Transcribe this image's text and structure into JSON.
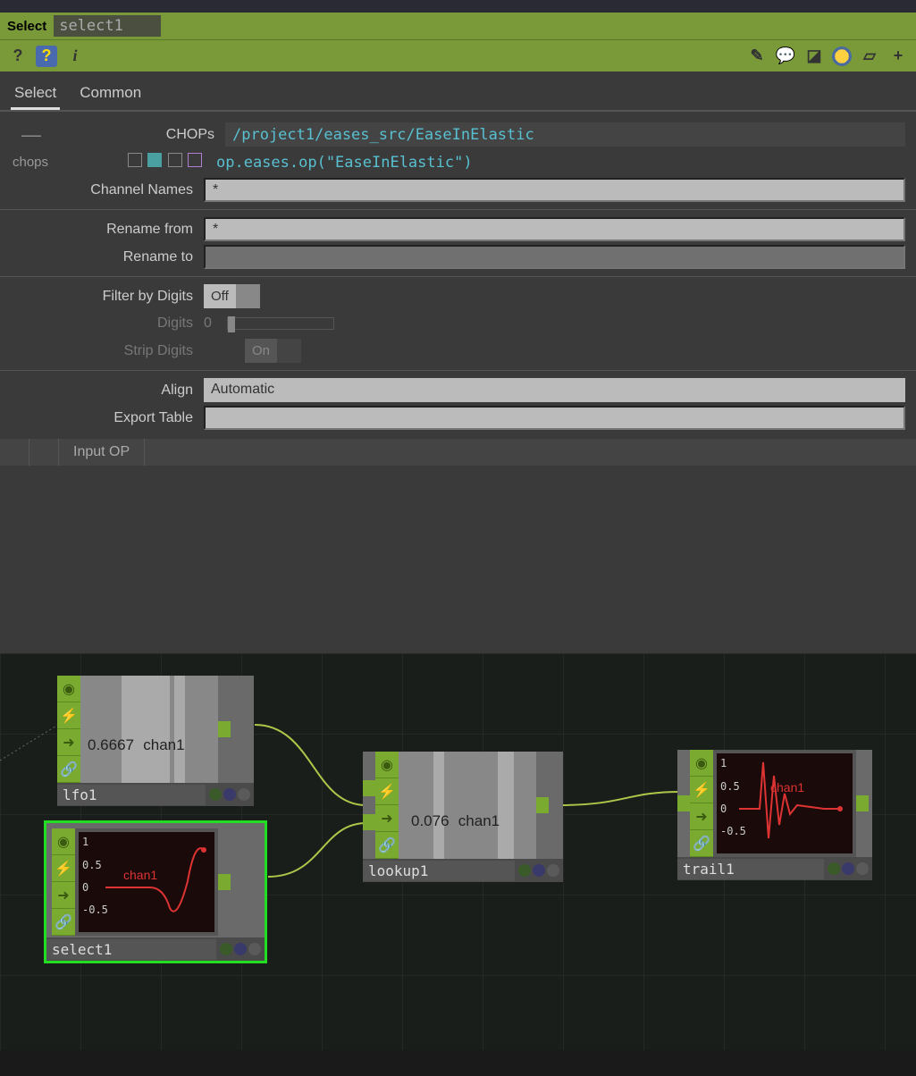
{
  "header": {
    "type_label": "Select",
    "op_name": "select1"
  },
  "tabs": {
    "select": "Select",
    "common": "Common"
  },
  "params": {
    "chops_label": "CHOPs",
    "chops_value": "/project1/eases_src/EaseInElastic",
    "chops_sublabel": "chops",
    "chops_expr": "op.eases.op(\"EaseInElastic\")",
    "channames_label": "Channel Names",
    "channames_value": "*",
    "renamefrom_label": "Rename from",
    "renamefrom_value": "*",
    "renameto_label": "Rename to",
    "renameto_value": "",
    "filterdigits_label": "Filter by Digits",
    "filterdigits_value": "Off",
    "digits_label": "Digits",
    "digits_value": "0",
    "stripdigits_label": "Strip Digits",
    "stripdigits_value": "On",
    "align_label": "Align",
    "align_value": "Automatic",
    "exporttable_label": "Export Table",
    "exporttable_value": "",
    "inputop_label": "Input OP"
  },
  "nodes": {
    "lfo1": {
      "name": "lfo1",
      "value": "0.6667",
      "chan": "chan1"
    },
    "select1": {
      "name": "select1",
      "chan": "chan1",
      "ticks": [
        "1",
        "0.5",
        "0",
        "-0.5"
      ]
    },
    "lookup1": {
      "name": "lookup1",
      "value": "0.076",
      "chan": "chan1"
    },
    "trail1": {
      "name": "trail1",
      "chan": "chan1",
      "ticks": [
        "1",
        "0.5",
        "0",
        "-0.5"
      ]
    }
  }
}
